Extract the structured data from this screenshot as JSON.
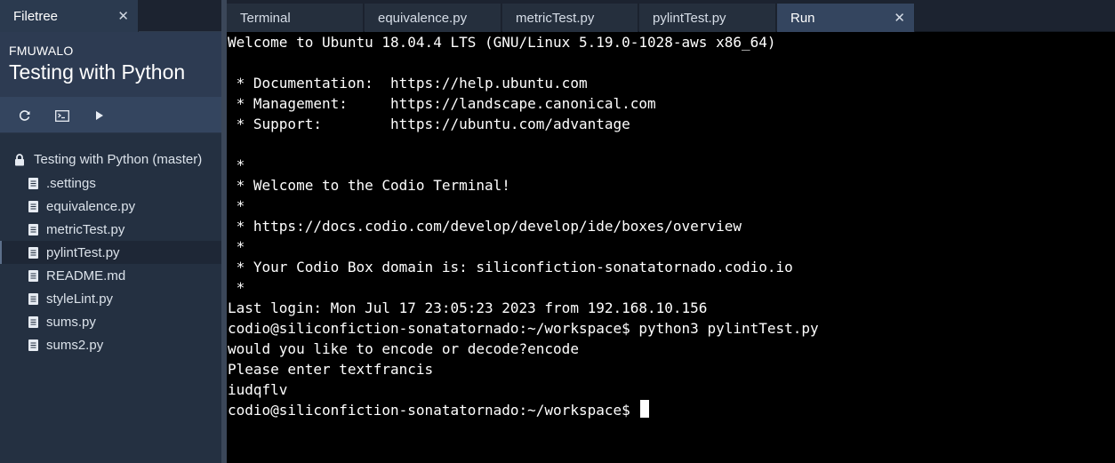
{
  "left_panel": {
    "tab_label": "Filetree",
    "tab_close": "✕",
    "project_owner": "FMUWALO",
    "project_title": "Testing with Python",
    "toolbar_icons": [
      "refresh-icon",
      "terminal-icon",
      "play-icon"
    ],
    "tree_root": "Testing with Python (master)",
    "files": [
      ".settings",
      "equivalence.py",
      "metricTest.py",
      "pylintTest.py",
      "README.md",
      "styleLint.py",
      "sums.py",
      "sums2.py"
    ],
    "selected_file": "pylintTest.py"
  },
  "tabs": [
    {
      "label": "Terminal",
      "active": false
    },
    {
      "label": "equivalence.py",
      "active": false
    },
    {
      "label": "metricTest.py",
      "active": false
    },
    {
      "label": "pylintTest.py",
      "active": false
    },
    {
      "label": "Run",
      "active": true,
      "close": "✕"
    }
  ],
  "terminal": {
    "lines": [
      "Welcome to Ubuntu 18.04.4 LTS (GNU/Linux 5.19.0-1028-aws x86_64)",
      "",
      " * Documentation:  https://help.ubuntu.com",
      " * Management:     https://landscape.canonical.com",
      " * Support:        https://ubuntu.com/advantage",
      "",
      " *",
      " * Welcome to the Codio Terminal!",
      " *",
      " * https://docs.codio.com/develop/develop/ide/boxes/overview",
      " *",
      " * Your Codio Box domain is: siliconfiction-sonatatornado.codio.io",
      " *",
      "Last login: Mon Jul 17 23:05:23 2023 from 192.168.10.156",
      "codio@siliconfiction-sonatatornado:~/workspace$ python3 pylintTest.py",
      "would you like to encode or decode?encode",
      "Please enter textfrancis",
      "iudqflv"
    ],
    "prompt": "codio@siliconfiction-sonatatornado:~/workspace$ "
  },
  "colors": {
    "sidebar_bg": "#243041",
    "header_bg": "#2d3b52",
    "toolbar_bg": "#34455f",
    "active_tab_bg": "#34455f",
    "terminal_bg": "#000000",
    "terminal_fg": "#ffffff"
  }
}
